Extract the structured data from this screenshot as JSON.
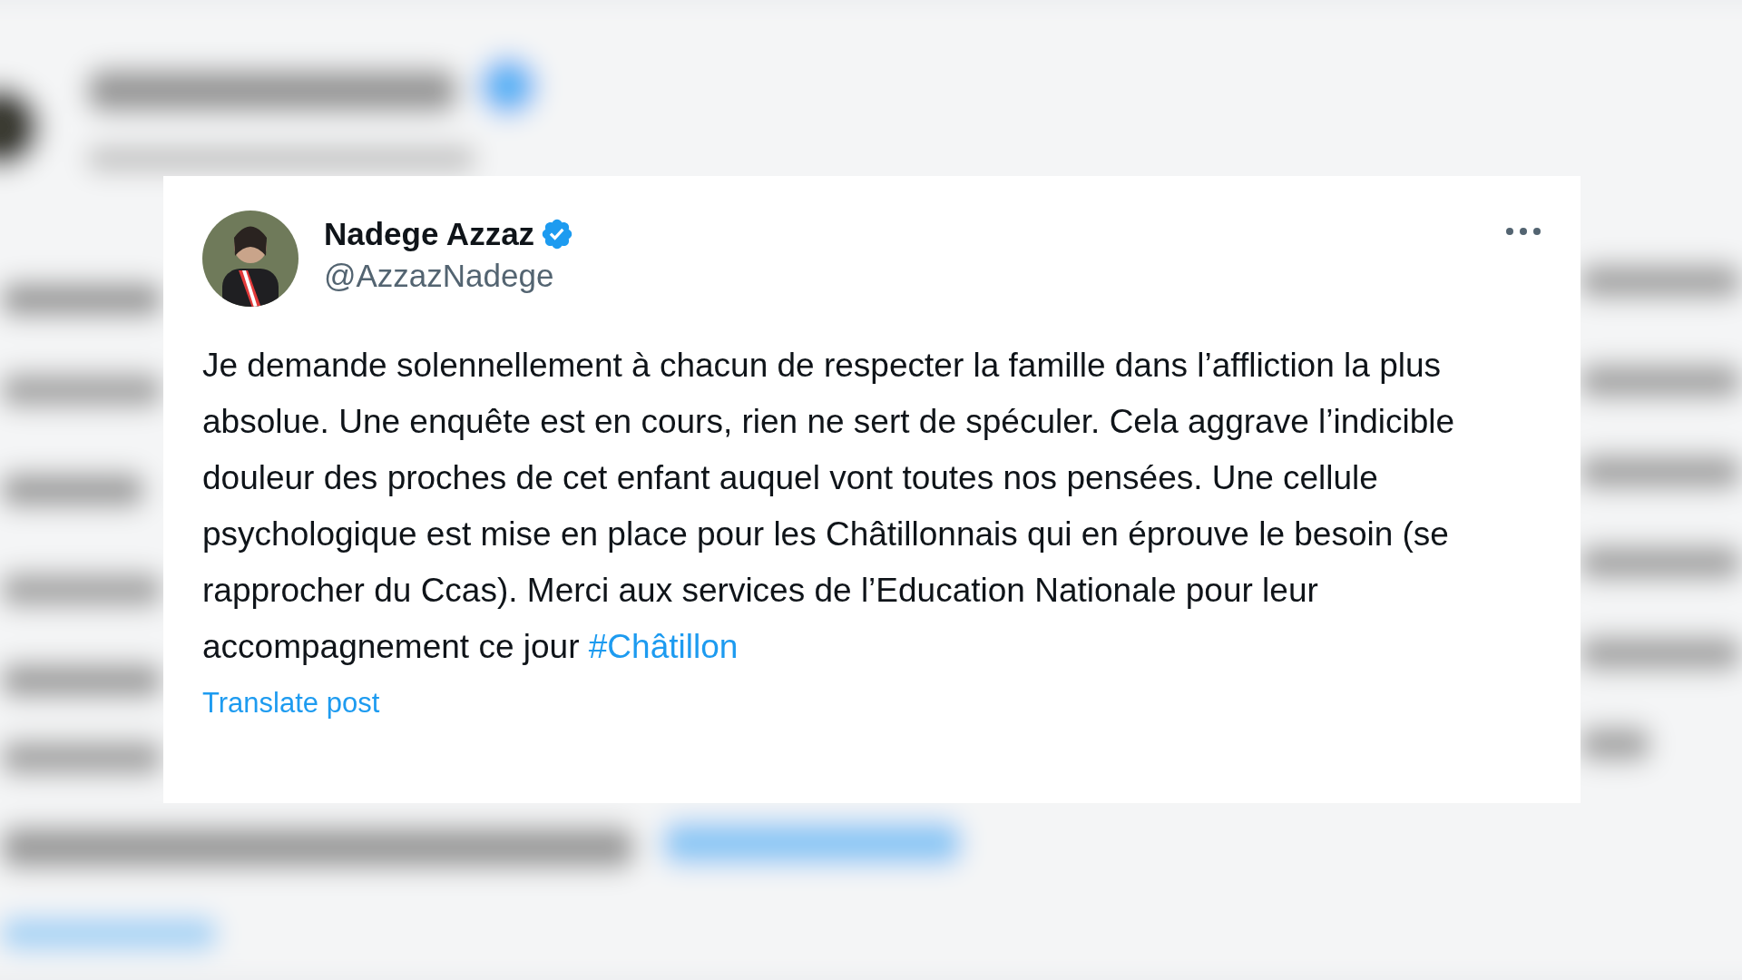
{
  "post": {
    "author": {
      "name": "Nadege Azzaz",
      "verified": true,
      "handle": "@AzzazNadege"
    },
    "text": "Je demande solennellement à chacun de respecter la famille dans l’affliction la plus absolue. Une enquête est en cours, rien ne sert de spéculer. Cela aggrave l’indicible douleur des proches de cet enfant auquel vont toutes nos pensées. Une cellule psychologique est mise en place pour les Châtillonnais qui en éprouve le besoin (se rapprocher du Ccas). Merci aux services de l’Education Nationale pour leur accompagnement ce jour",
    "hashtag": "#Châtillon",
    "translate_link": "Translate post"
  }
}
